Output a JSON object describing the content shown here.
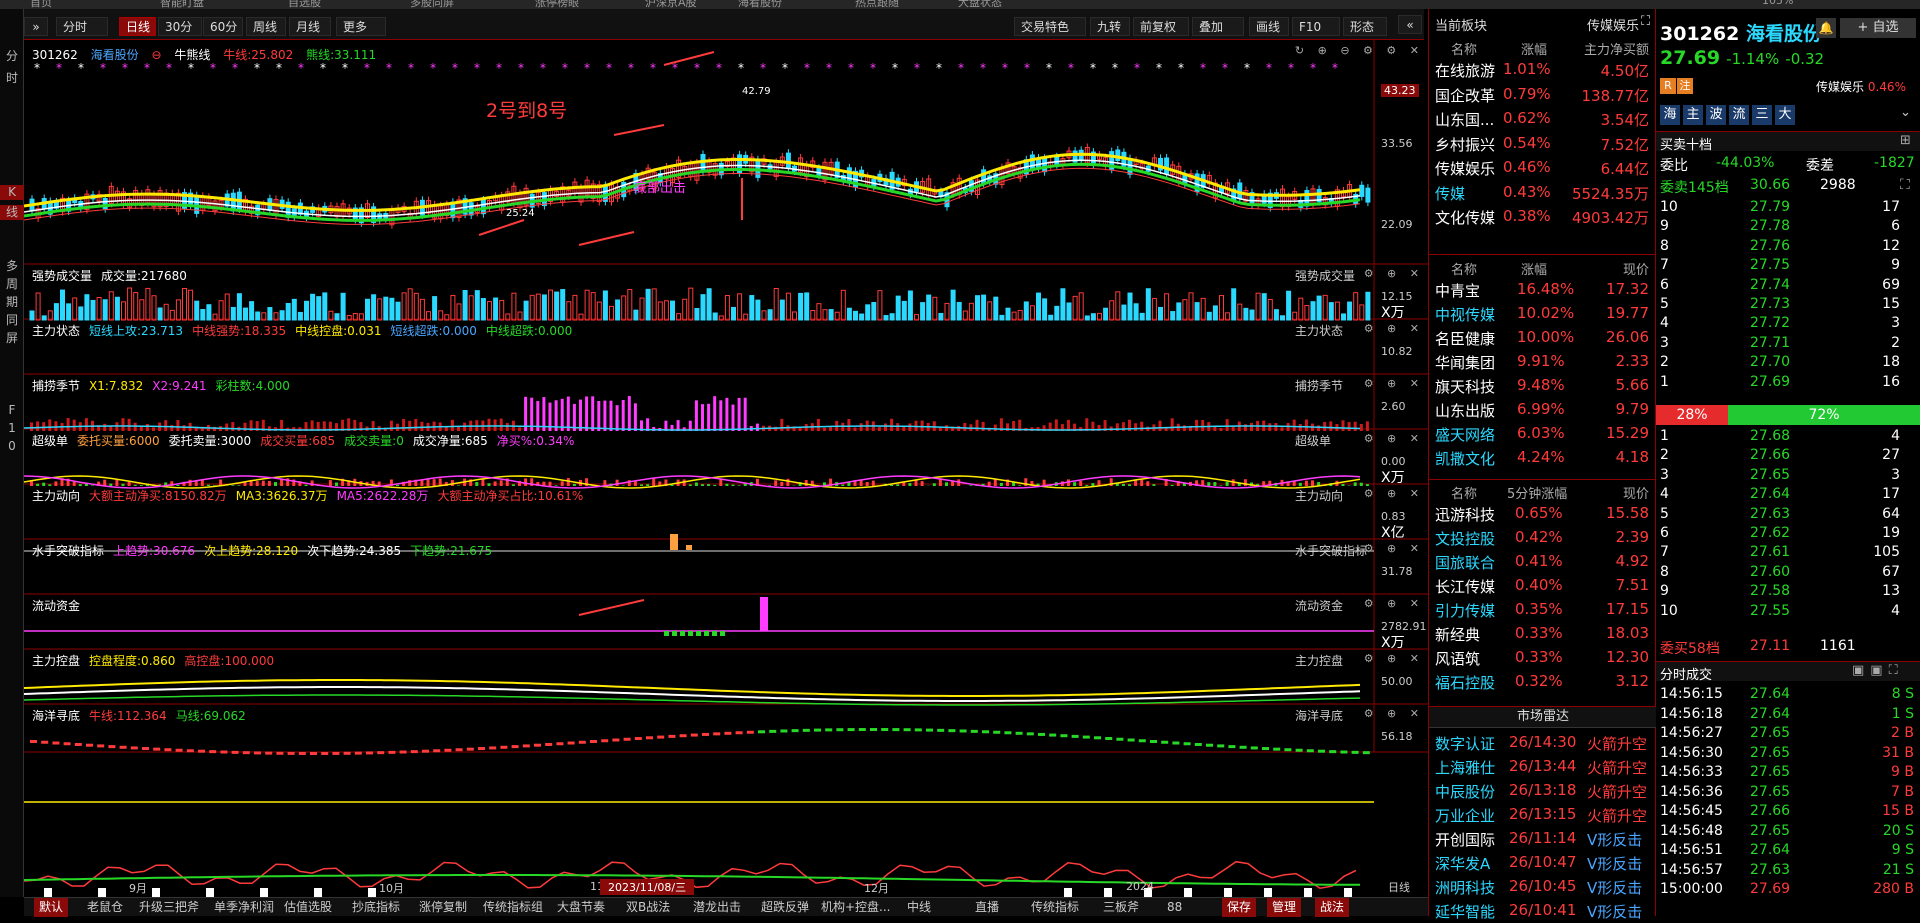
{
  "top_tabs": [
    "首页",
    "智能盯盘",
    "自选股",
    "多股同屏",
    "涨停榜眼",
    "沪深京A股",
    "海看股份",
    "热点跟随",
    "大盘状态"
  ],
  "top_zoom": "105%",
  "left_sidebar": {
    "items": [
      "分",
      "时",
      "K",
      "线",
      "多",
      "周",
      "期",
      "同",
      "屏",
      "F",
      "1",
      "0"
    ]
  },
  "toolbar": {
    "periods": [
      "分时",
      "日线",
      "30分",
      "60分",
      "周线",
      "月线",
      "更多"
    ],
    "active": "日线",
    "right_tools": [
      "交易特色",
      "九转",
      "前复权",
      "叠加",
      "画线",
      "F10",
      "形态"
    ]
  },
  "main_chart": {
    "code": "301262",
    "name": "海看股份",
    "ind_name": "牛熊线",
    "niu": "牛线:25.802",
    "xiong": "熊线:33.111",
    "price_labels": [
      "43.23",
      "33.56",
      "22.09"
    ],
    "high_label": "42.79",
    "low_label": "25.24",
    "annotation": "2号到8号",
    "banner": "底部出击"
  },
  "panels": [
    {
      "id": "vol",
      "title": "强势成交量",
      "items": [
        {
          "t": "成交量:217680",
          "c": "#ffffff"
        }
      ],
      "axis": [
        "12.15",
        "X万"
      ]
    },
    {
      "id": "zlzt",
      "title": "主力状态",
      "items": [
        {
          "t": "短线上攻:23.713",
          "c": "#2bd9ff"
        },
        {
          "t": "中线强势:18.335",
          "c": "#ff3b3b"
        },
        {
          "t": "中线控盘:0.031",
          "c": "#ffea00"
        },
        {
          "t": "短线超跌:0.000",
          "c": "#4aa6ff"
        },
        {
          "t": "中线超跌:0.000",
          "c": "#27d827"
        }
      ],
      "axis": [
        "10.82",
        ""
      ]
    },
    {
      "id": "blj",
      "title": "捕捞季节",
      "items": [
        {
          "t": "X1:7.832",
          "c": "#ffea00"
        },
        {
          "t": "X2:9.241",
          "c": "#ff3cff"
        },
        {
          "t": "彩柱数:4.000",
          "c": "#27d827"
        }
      ],
      "axis": [
        "2.60",
        ""
      ]
    },
    {
      "id": "cjd",
      "title": "超级单",
      "items": [
        {
          "t": "委托买量:6000",
          "c": "#ffa040"
        },
        {
          "t": "委托卖量:3000",
          "c": "#ffffff"
        },
        {
          "t": "成交买量:685",
          "c": "#ff3b3b"
        },
        {
          "t": "成交卖量:0",
          "c": "#27d827"
        },
        {
          "t": "成交净量:685",
          "c": "#ffffff"
        },
        {
          "t": "净买%:0.34%",
          "c": "#ff3cff"
        }
      ],
      "axis": [
        "0.00",
        "X万"
      ]
    },
    {
      "id": "zldx",
      "title": "主力动向",
      "items": [
        {
          "t": "大额主动净买:8150.82万",
          "c": "#ff3b3b"
        },
        {
          "t": "MA3:3626.37万",
          "c": "#ffea00"
        },
        {
          "t": "MA5:2622.28万",
          "c": "#ff3cff"
        },
        {
          "t": "大额主动净买占比:10.61%",
          "c": "#ff3b3b"
        }
      ],
      "axis": [
        "0.83",
        "X亿"
      ]
    },
    {
      "id": "sstp",
      "title": "水手突破指标",
      "items": [
        {
          "t": "上趋势:30.676",
          "c": "#ff3cff"
        },
        {
          "t": "次上趋势:28.120",
          "c": "#ffea00"
        },
        {
          "t": "次下趋势:24.385",
          "c": "#ffffff"
        },
        {
          "t": "下趋势:21.675",
          "c": "#27d827"
        }
      ],
      "axis": [
        "31.78",
        ""
      ]
    },
    {
      "id": "ldzj",
      "title": "流动资金",
      "items": [],
      "axis": [
        "2782.91",
        "X万"
      ]
    },
    {
      "id": "zlkp",
      "title": "主力控盘",
      "items": [
        {
          "t": "控盘程度:0.860",
          "c": "#ffea00"
        },
        {
          "t": "高控盘:100.000",
          "c": "#ff3b3b"
        }
      ],
      "axis": [
        "50.00",
        ""
      ]
    },
    {
      "id": "hyxd",
      "title": "海洋寻底",
      "items": [
        {
          "t": "牛线:112.364",
          "c": "#ff3b3b"
        },
        {
          "t": "马线:69.062",
          "c": "#27d827"
        }
      ],
      "axis": [
        "56.18",
        ""
      ]
    }
  ],
  "x_axis": {
    "labels": [
      "9月",
      "10月",
      "11",
      "12月",
      "2024"
    ],
    "current_date": "2023/11/08/三",
    "period": "日线"
  },
  "bottom_tabs": [
    "默认",
    "老鼠仓",
    "升级三把斧",
    "单季净利润",
    "估值选股",
    "抄底指标",
    "涨停复制",
    "传统指标组",
    "大盘节奏",
    "双B战法",
    "潜龙出击",
    "超跌反弹",
    "机构+控盘...",
    "中线",
    "直播",
    "传统指标",
    "三板斧",
    "88",
    "保存",
    "管理",
    "战法"
  ],
  "sector": {
    "title": "当前板块",
    "current": "传媒娱乐",
    "headers": [
      "名称",
      "涨幅",
      "主力净买额"
    ],
    "rows": [
      [
        "在线旅游",
        "1.01%",
        "4.50亿"
      ],
      [
        "国企改革",
        "0.79%",
        "138.77亿"
      ],
      [
        "山东国...",
        "0.62%",
        "3.54亿"
      ],
      [
        "乡村振兴",
        "0.54%",
        "7.52亿"
      ],
      [
        "传媒娱乐",
        "0.46%",
        "6.44亿"
      ],
      [
        "传媒",
        "0.43%",
        "5524.35万"
      ],
      [
        "文化传媒",
        "0.38%",
        "4903.42万"
      ]
    ]
  },
  "stocks": {
    "headers": [
      "名称",
      "涨幅",
      "现价"
    ],
    "rows": [
      [
        "中青宝",
        "16.48%",
        "17.32"
      ],
      [
        "中视传媒",
        "10.02%",
        "19.77"
      ],
      [
        "名臣健康",
        "10.00%",
        "26.06"
      ],
      [
        "华闻集团",
        "9.91%",
        "2.33"
      ],
      [
        "旗天科技",
        "9.48%",
        "5.66"
      ],
      [
        "山东出版",
        "6.99%",
        "9.79"
      ],
      [
        "盛天网络",
        "6.03%",
        "15.29"
      ],
      [
        "凯撒文化",
        "4.24%",
        "4.18"
      ]
    ]
  },
  "speed": {
    "headers": [
      "名称",
      "5分钟涨幅",
      "现价"
    ],
    "rows": [
      [
        "迅游科技",
        "0.65%",
        "15.58"
      ],
      [
        "文投控股",
        "0.42%",
        "2.39"
      ],
      [
        "国旅联合",
        "0.41%",
        "4.92"
      ],
      [
        "长江传媒",
        "0.40%",
        "7.51"
      ],
      [
        "引力传媒",
        "0.35%",
        "17.15"
      ],
      [
        "新经典",
        "0.33%",
        "18.03"
      ],
      [
        "风语筑",
        "0.33%",
        "12.30"
      ],
      [
        "福石控股",
        "0.32%",
        "3.12"
      ]
    ]
  },
  "radar": {
    "title": "市场雷达",
    "rows": [
      [
        "数字认证",
        "26/14:30",
        "火箭升空"
      ],
      [
        "上海雅仕",
        "26/13:44",
        "火箭升空"
      ],
      [
        "中辰股份",
        "26/13:18",
        "火箭升空"
      ],
      [
        "万业企业",
        "26/13:15",
        "火箭升空"
      ],
      [
        "开创国际",
        "26/11:14",
        "V形反击"
      ],
      [
        "深华发A",
        "26/10:47",
        "V形反击"
      ],
      [
        "洲明科技",
        "26/10:45",
        "V形反击"
      ],
      [
        "延华智能",
        "26/10:41",
        "V形反击"
      ]
    ]
  },
  "quote": {
    "code": "301262",
    "name": "海看股份",
    "price": "27.69",
    "change_pct": "-1.14%",
    "change": "-0.32",
    "sector": "传媒娱乐",
    "sector_pct": "0.46%",
    "add_btn": "+ 自选",
    "tags": [
      "R",
      "注"
    ],
    "quick": [
      "海",
      "主",
      "波",
      "流",
      "三",
      "大"
    ]
  },
  "orderbook": {
    "title": "买卖十档",
    "weibi": "-44.03%",
    "weicha": "-1827",
    "sell_total": [
      "委卖145档",
      "30.66",
      "2988"
    ],
    "sells": [
      [
        "10",
        "27.79",
        "17"
      ],
      [
        "9",
        "27.78",
        "6"
      ],
      [
        "8",
        "27.76",
        "12"
      ],
      [
        "7",
        "27.75",
        "9"
      ],
      [
        "6",
        "27.74",
        "69"
      ],
      [
        "5",
        "27.73",
        "15"
      ],
      [
        "4",
        "27.72",
        "3"
      ],
      [
        "3",
        "27.71",
        "2"
      ],
      [
        "2",
        "27.70",
        "18"
      ],
      [
        "1",
        "27.69",
        "16"
      ]
    ],
    "ratio": [
      "28%",
      "72%"
    ],
    "buys": [
      [
        "1",
        "27.68",
        "4"
      ],
      [
        "2",
        "27.66",
        "27"
      ],
      [
        "3",
        "27.65",
        "3"
      ],
      [
        "4",
        "27.64",
        "17"
      ],
      [
        "5",
        "27.63",
        "64"
      ],
      [
        "6",
        "27.62",
        "19"
      ],
      [
        "7",
        "27.61",
        "105"
      ],
      [
        "8",
        "27.60",
        "67"
      ],
      [
        "9",
        "27.58",
        "13"
      ],
      [
        "10",
        "27.55",
        "4"
      ]
    ],
    "buy_total": [
      "委买58档",
      "27.11",
      "1161"
    ]
  },
  "trades": {
    "title": "分时成交",
    "rows": [
      [
        "14:56:15",
        "27.64",
        "8 S"
      ],
      [
        "14:56:18",
        "27.64",
        "1 S"
      ],
      [
        "14:56:27",
        "27.65",
        "2 B"
      ],
      [
        "14:56:30",
        "27.65",
        "31 B"
      ],
      [
        "14:56:33",
        "27.65",
        "9 B"
      ],
      [
        "14:56:36",
        "27.65",
        "7 B"
      ],
      [
        "14:56:45",
        "27.66",
        "15 B"
      ],
      [
        "14:56:48",
        "27.65",
        "20 S"
      ],
      [
        "14:56:51",
        "27.64",
        "9 S"
      ],
      [
        "14:56:57",
        "27.63",
        "21 S"
      ],
      [
        "15:00:00",
        "27.69",
        "280 B"
      ]
    ]
  }
}
